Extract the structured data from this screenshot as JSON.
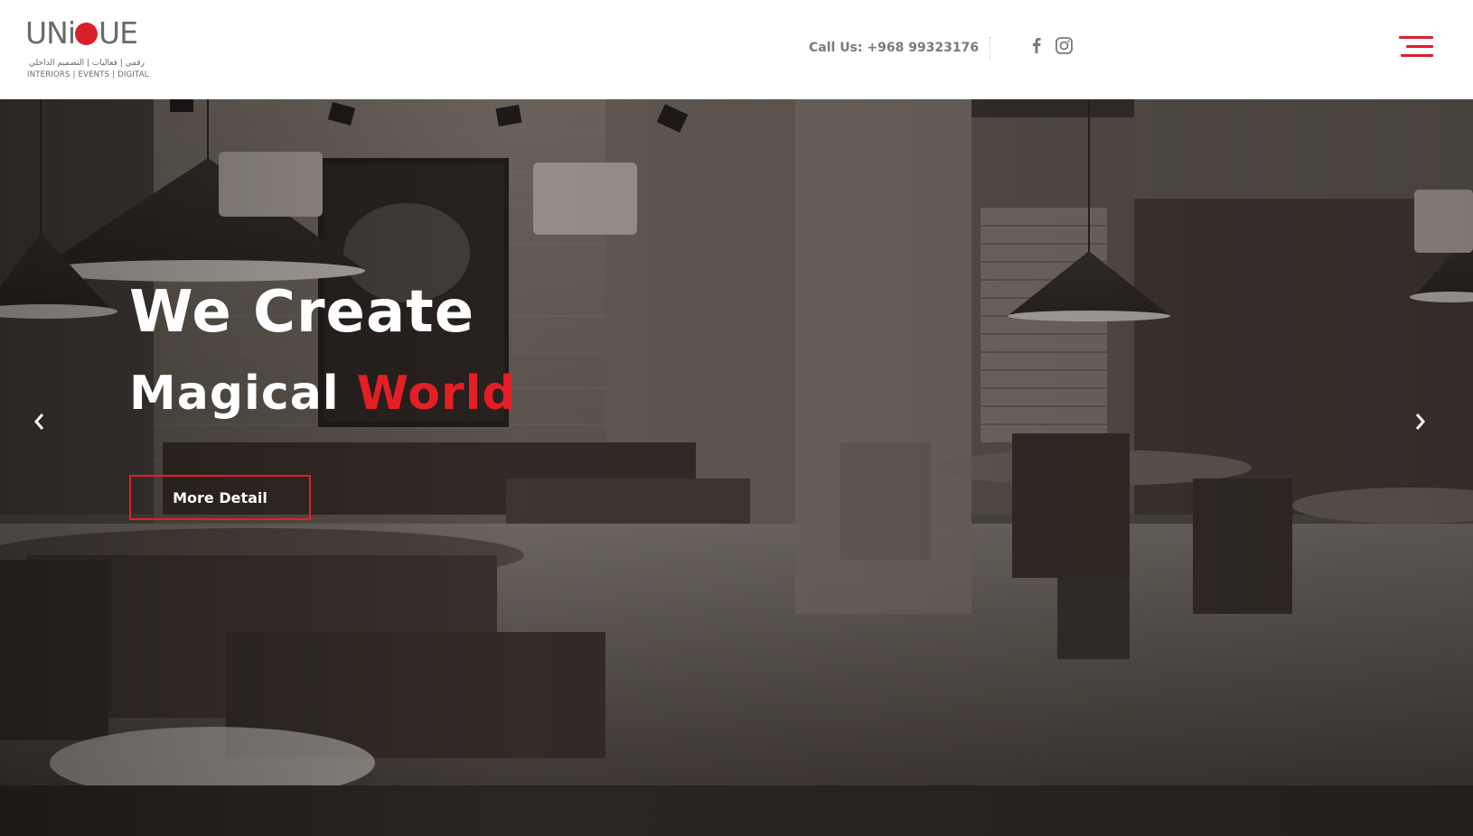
{
  "brand": {
    "logo_text_before": "UNi",
    "logo_text_after": "UE",
    "logo_arabic": "رقمي | فعاليات | التصميم الداخلي",
    "logo_tagline": "INTERIORS | EVENTS | DIGITAL"
  },
  "header": {
    "call_us": "Call Us: +968 99323176",
    "social": [
      {
        "name": "facebook",
        "icon": "facebook-icon"
      },
      {
        "name": "instagram",
        "icon": "instagram-icon"
      }
    ],
    "menu_icon": "hamburger-menu-icon"
  },
  "hero": {
    "title_line1": "We Create",
    "title_line2_white": "Magical",
    "title_line2_accent": "World",
    "cta_label": "More Detail",
    "prev_icon": "chevron-left-icon",
    "next_icon": "chevron-right-icon"
  },
  "colors": {
    "accent_red": "#e51e25",
    "logo_grey": "#6c6a6b",
    "header_text_grey": "#7a7a7a",
    "header_bg": "#ffffff"
  }
}
